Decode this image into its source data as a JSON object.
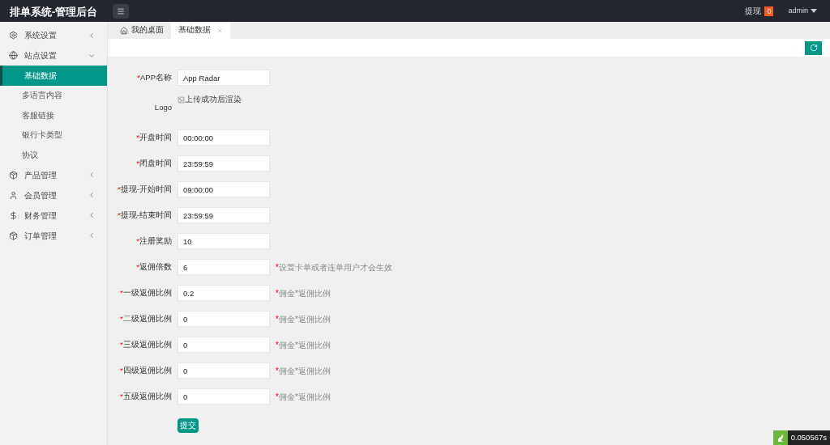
{
  "header": {
    "title": "排单系统-管理后台",
    "withdraw": {
      "label": "提现",
      "count": "0"
    },
    "user": "admin"
  },
  "sidebar": {
    "items": [
      {
        "label": "系统设置",
        "expanded": false
      },
      {
        "label": "站点设置",
        "expanded": true,
        "children": [
          {
            "label": "基础数据",
            "selected": true
          },
          {
            "label": "多语言内容",
            "selected": false
          },
          {
            "label": "客服链接",
            "selected": false
          },
          {
            "label": "银行卡类型",
            "selected": false
          },
          {
            "label": "协议",
            "selected": false
          }
        ]
      },
      {
        "label": "产品管理",
        "expanded": false
      },
      {
        "label": "会员管理",
        "expanded": false
      },
      {
        "label": "财务管理",
        "expanded": false
      },
      {
        "label": "订单管理",
        "expanded": false
      }
    ]
  },
  "tabs": [
    {
      "label": "我的桌面",
      "selected": false
    },
    {
      "label": "基础数据",
      "selected": true
    }
  ],
  "form": {
    "fields": [
      {
        "kind": "input",
        "mark": "*",
        "label": "APP名称",
        "value": "App Radar"
      },
      {
        "kind": "image",
        "label": "Logo",
        "alt": "上传成功后渲染"
      },
      {
        "kind": "input",
        "mark": "*",
        "label": "开盘时间",
        "value": "00:00:00"
      },
      {
        "kind": "input",
        "mark": "*",
        "label": "闭盘时间",
        "value": "23:59:59"
      },
      {
        "kind": "input",
        "mark": "*",
        "label": "提现-开始时间",
        "value": "09:00:00"
      },
      {
        "kind": "input",
        "mark": "*",
        "label": "提现-结束时间",
        "value": "23:59:59"
      },
      {
        "kind": "input",
        "mark": "*",
        "label": "注册奖励",
        "value": "10"
      },
      {
        "kind": "input",
        "mark": "*",
        "label": "返佣倍数",
        "value": "6",
        "hint": {
          "mark": "*",
          "text": "设置卡单或者连单用户才会生效"
        }
      },
      {
        "kind": "input",
        "mark": "*",
        "label": "一级返佣比例",
        "value": "0.2",
        "hint": {
          "mark": "*",
          "text": "佣金*返佣比例"
        }
      },
      {
        "kind": "input",
        "mark": "*",
        "label": "二级返佣比例",
        "value": "0",
        "hint": {
          "mark": "*",
          "text": "佣金*返佣比例"
        }
      },
      {
        "kind": "input",
        "mark": "*",
        "label": "三级返佣比例",
        "value": "0",
        "hint": {
          "mark": "*",
          "text": "佣金*返佣比例"
        }
      },
      {
        "kind": "input",
        "mark": "*",
        "label": "四级返佣比例",
        "value": "0",
        "hint": {
          "mark": "*",
          "text": "佣金*返佣比例"
        }
      },
      {
        "kind": "input",
        "mark": "*",
        "label": "五级返佣比例",
        "value": "0",
        "hint": {
          "mark": "*",
          "text": "佣金*返佣比例"
        }
      }
    ],
    "submit": "提交"
  },
  "debug": {
    "time": "0.050567s"
  }
}
